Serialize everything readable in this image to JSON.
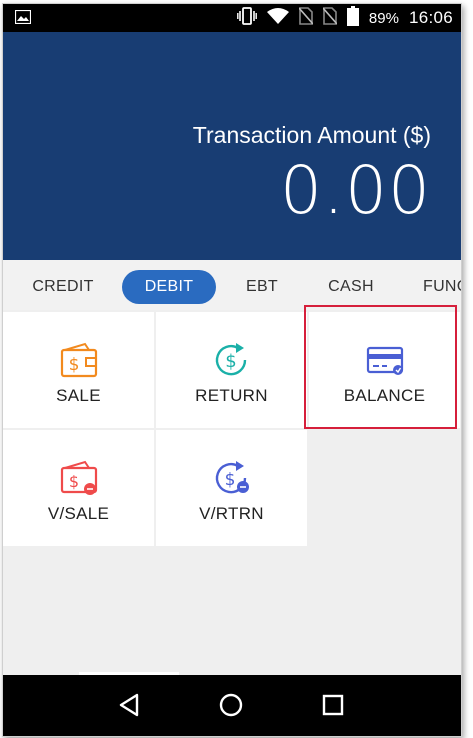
{
  "status_bar": {
    "battery_percent": "89%",
    "time": "16:06",
    "icons": [
      "image-icon",
      "vibrate-icon",
      "wifi-icon",
      "no-sim-icon",
      "no-sim-icon",
      "battery-icon"
    ]
  },
  "header": {
    "amount_label": "Transaction Amount ($)",
    "amount_value": "0.00"
  },
  "tabs": [
    {
      "label": "CREDIT",
      "active": false
    },
    {
      "label": "DEBIT",
      "active": true
    },
    {
      "label": "EBT",
      "active": false
    },
    {
      "label": "CASH",
      "active": false
    },
    {
      "label": "FUNC",
      "active": false
    }
  ],
  "grid": {
    "tiles": [
      {
        "label": "SALE",
        "icon": "wallet-dollar-icon",
        "color": "#f28a1e"
      },
      {
        "label": "RETURN",
        "icon": "dollar-return-icon",
        "color": "#1ab0a8"
      },
      {
        "label": "BALANCE",
        "icon": "card-balance-icon",
        "color": "#4a5fd4"
      },
      {
        "label": "V/SALE",
        "icon": "void-sale-icon",
        "color": "#ef4b4b"
      },
      {
        "label": "V/RTRN",
        "icon": "void-return-icon",
        "color": "#4a5fd4"
      }
    ]
  },
  "nav_bar": {
    "buttons": [
      "back-icon",
      "home-icon",
      "recents-icon"
    ]
  },
  "colors": {
    "header_bg": "#183d73",
    "active_tab": "#2a6bc0",
    "highlight": "#d61f3b"
  }
}
